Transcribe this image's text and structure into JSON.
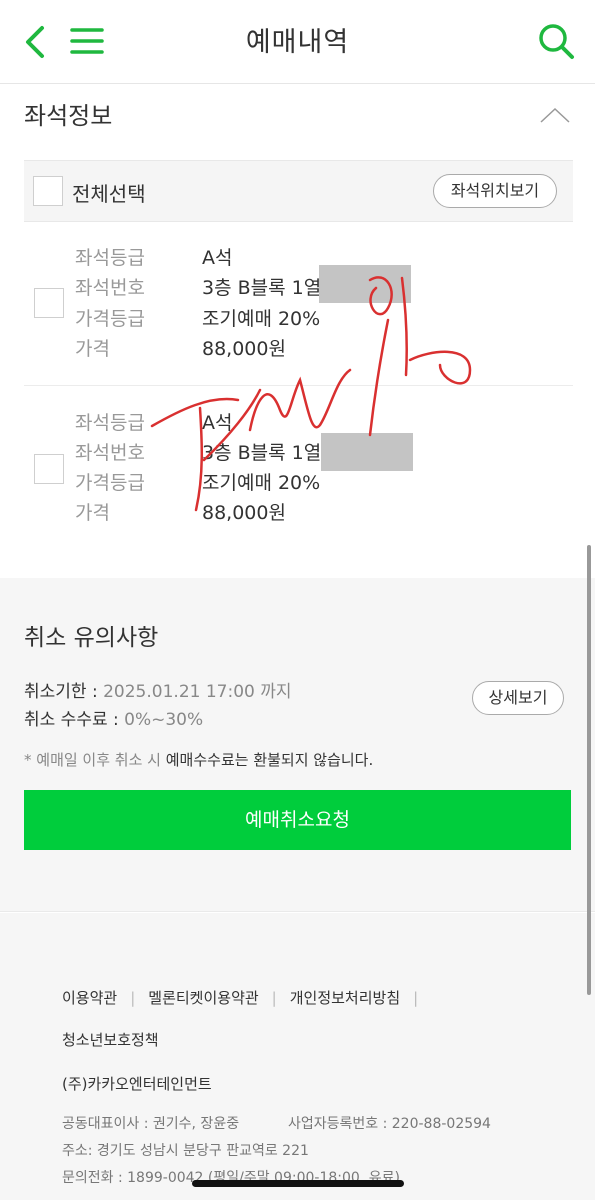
{
  "header": {
    "title": "예매내역"
  },
  "seat_info": {
    "section_title": "좌석정보",
    "select_all_label": "전체선택",
    "seat_location_button": "좌석위치보기",
    "seats": [
      {
        "grade_label": "좌석등급",
        "grade": "A석",
        "number_label": "좌석번호",
        "number": "3층 B블록 1열",
        "price_grade_label": "가격등급",
        "price_grade": "조기예매 20%",
        "price_label": "가격",
        "price": "88,000원"
      },
      {
        "grade_label": "좌석등급",
        "grade": "A석",
        "number_label": "좌석번호",
        "number": "3층 B블록 1열",
        "price_grade_label": "가격등급",
        "price_grade": "조기예매 20%",
        "price_label": "가격",
        "price": "88,000원"
      }
    ]
  },
  "cancel": {
    "title": "취소 유의사항",
    "deadline_label": "취소기한 : ",
    "deadline_value": "2025.01.21 17:00 까지",
    "fee_label": "취소 수수료 : ",
    "fee_value": "0%~30%",
    "detail_button": "상세보기",
    "notice_prefix": "* 예매일 이후 취소 시 ",
    "notice_bold": "예매수수료는 환불되지 않습니다.",
    "cancel_request_button": "예매취소요청"
  },
  "footer": {
    "links": [
      "이용약관",
      "멜론티켓이용약관",
      "개인정보처리방침"
    ],
    "link_youth": "청소년보호정책",
    "company": "(주)카카오엔터테인먼트",
    "ceo": "공동대표이사 : 권기수, 장윤중",
    "biz_no": "사업자등록번호 : 220-88-02594",
    "address": "주소: 경기도 성남시 분당구 판교역로 221",
    "phone": "문의전화 : 1899-0042 (평일/주말 09:00-18:00, 유료)"
  },
  "colors": {
    "accent": "#00cd3c",
    "icon": "#1fb83f"
  },
  "icons": [
    "back-icon",
    "menu-icon",
    "search-icon",
    "chevron-up-icon"
  ]
}
